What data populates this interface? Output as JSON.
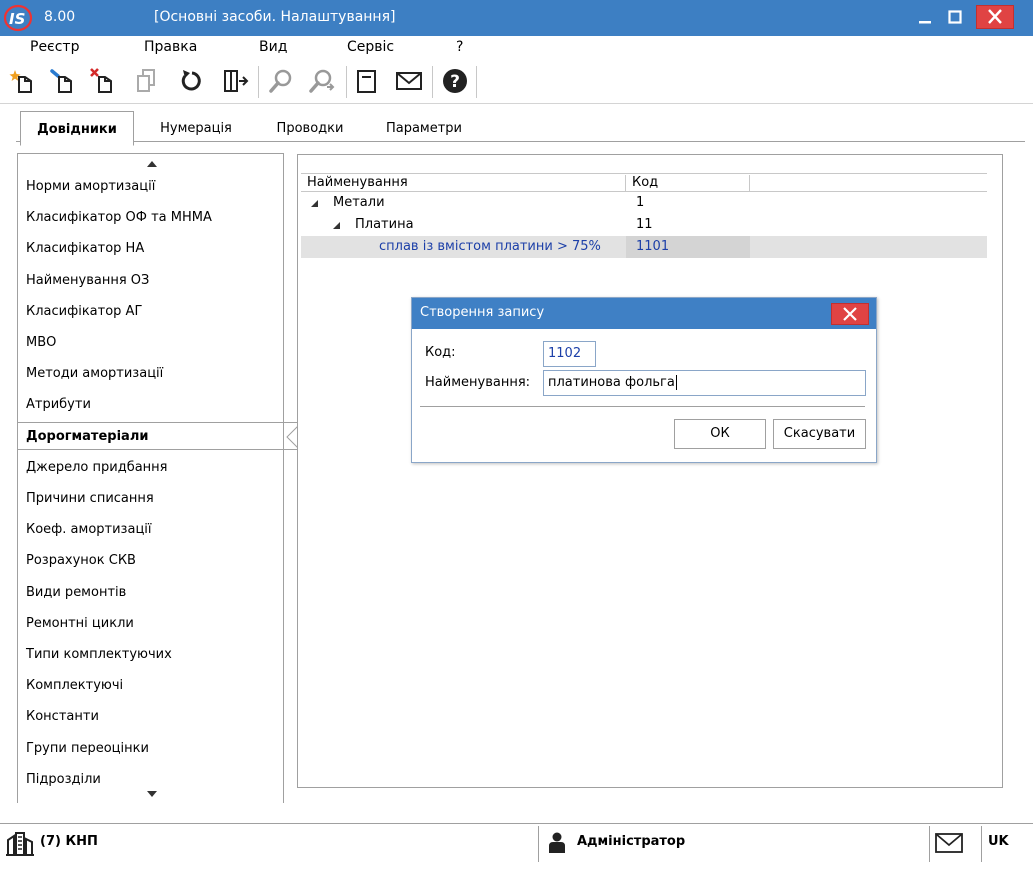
{
  "window": {
    "version": "8.00",
    "title": "[Основні засоби. Налаштування]",
    "logo_text": "IS"
  },
  "menu": [
    "Реєстр",
    "Правка",
    "Вид",
    "Сервіс",
    "?"
  ],
  "toolbar": {
    "icons": [
      "create-icon",
      "edit-icon",
      "delete-icon",
      "copy-icon",
      "refresh-icon",
      "exit-icon",
      "find-icon",
      "find-next-icon",
      "note-icon",
      "mail-icon",
      "help-icon"
    ]
  },
  "tabs": [
    {
      "label": "Довідники",
      "active": true
    },
    {
      "label": "Нумерація",
      "active": false
    },
    {
      "label": "Проводки",
      "active": false
    },
    {
      "label": "Параметри",
      "active": false
    }
  ],
  "nav": {
    "items": [
      "Норми амортизації",
      "Класифікатор ОФ та МНМА",
      "Класифікатор НА",
      "Найменування ОЗ",
      "Класифікатор АГ",
      "МВО",
      "Методи амортизації",
      "Атрибути",
      "Дорогматеріали",
      "Джерело придбання",
      "Причини списання",
      "Коеф. амортизації",
      "Розрахунок СКВ",
      "Види ремонтів",
      "Ремонтні цикли",
      "Типи комплектуючих",
      "Комплектуючі",
      "Константи",
      "Групи переоцінки",
      "Підрозділи"
    ],
    "active_index": 8
  },
  "grid": {
    "columns": {
      "name": "Найменування",
      "code": "Код"
    },
    "rows": [
      {
        "name": "Метали",
        "code": "1",
        "level": 0,
        "expanded": true,
        "selected": false
      },
      {
        "name": "Платина",
        "code": "11",
        "level": 1,
        "expanded": true,
        "selected": false
      },
      {
        "name": "сплав із вмістом платини > 75%",
        "code": "1101",
        "level": 2,
        "expanded": false,
        "selected": true
      }
    ]
  },
  "dialog": {
    "title": "Створення запису",
    "code_label": "Код:",
    "code_value": "1102",
    "name_label": "Найменування:",
    "name_value": "платинова фольга",
    "ok_label": "ОК",
    "cancel_label": "Скасувати"
  },
  "status": {
    "org": "(7) КНП",
    "user": "Адміністратор",
    "lang": "UK"
  },
  "colors": {
    "titlebar": "#3d7fc3",
    "close": "#e04343",
    "link": "#1c3fa8"
  }
}
